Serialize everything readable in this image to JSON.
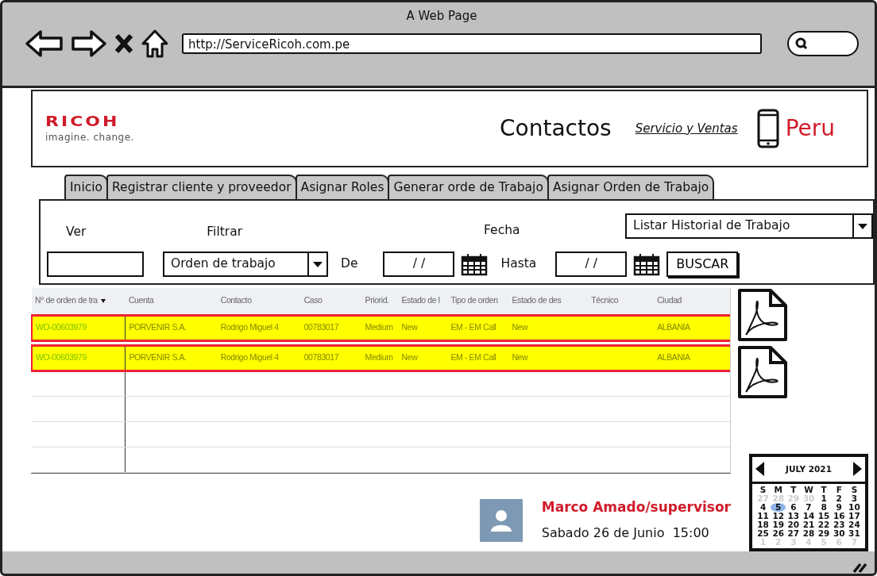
{
  "window": {
    "title": "A Web Page",
    "url": "http://ServiceRicoh.com.pe"
  },
  "header": {
    "logo": "RICOH",
    "tagline": "imagine. change.",
    "title": "Contactos",
    "link": "Servicio y Ventas",
    "country": "Peru"
  },
  "tabs": [
    {
      "label": "Inicio",
      "selected": false
    },
    {
      "label": "Registrar cliente y proveedor",
      "selected": false
    },
    {
      "label": "Asignar Roles",
      "selected": false
    },
    {
      "label": "Generar orde de Trabajo",
      "selected": false
    },
    {
      "label": "Asignar Orden de Trabajo",
      "selected": false
    }
  ],
  "filters": {
    "ver_label": "Ver",
    "filtrar_label": "Filtrar",
    "fecha_label": "Fecha",
    "list_select": "Listar Historial de Trabajo",
    "filtrar_select": "Orden de trabajo",
    "de_label": "De",
    "de_value": "/ /",
    "hasta_label": "Hasta",
    "hasta_value": "/ /",
    "search_button": "BUSCAR"
  },
  "table": {
    "columns": [
      "N° de orden de tra",
      "Cuenta",
      "Contacto",
      "Caso",
      "Priorid.",
      "Estado de l",
      "Tipo de orden",
      "Estado de des",
      "Técnico",
      "Ciudad"
    ],
    "rows": [
      {
        "highlighted": true,
        "cells": [
          "WO-00603979",
          "PORVENIR S.A.",
          "Rodrigo Miguel 4",
          "00783017",
          "Medium",
          "New",
          "EM - EM Call",
          "New",
          "",
          "ALBANIA"
        ]
      },
      {
        "highlighted": true,
        "cells": [
          "WO-00603979",
          "PORVENIR S.A.",
          "Rodrigo Miguel 4",
          "00783017",
          "Medium",
          "New",
          "EM - EM Call",
          "New",
          "",
          "ALBANIA"
        ]
      }
    ]
  },
  "user": {
    "name": "Marco Amado/supervisor",
    "date": "Sabado 26 de Junio  15:00"
  },
  "calendar": {
    "month": "JULY 2021",
    "weekdays": [
      "S",
      "M",
      "T",
      "W",
      "T",
      "F",
      "S"
    ],
    "days": [
      {
        "day": "27",
        "muted": true,
        "selected": false
      },
      {
        "day": "28",
        "muted": true,
        "selected": false
      },
      {
        "day": "29",
        "muted": true,
        "selected": false
      },
      {
        "day": "30",
        "muted": true,
        "selected": false
      },
      {
        "day": "1",
        "muted": false,
        "selected": false
      },
      {
        "day": "2",
        "muted": false,
        "selected": false
      },
      {
        "day": "3",
        "muted": false,
        "selected": false
      },
      {
        "day": "4",
        "muted": false,
        "selected": false
      },
      {
        "day": "5",
        "muted": false,
        "selected": true
      },
      {
        "day": "6",
        "muted": false,
        "selected": false
      },
      {
        "day": "7",
        "muted": false,
        "selected": false
      },
      {
        "day": "8",
        "muted": false,
        "selected": false
      },
      {
        "day": "9",
        "muted": false,
        "selected": false
      },
      {
        "day": "10",
        "muted": false,
        "selected": false
      },
      {
        "day": "11",
        "muted": false,
        "selected": false
      },
      {
        "day": "12",
        "muted": false,
        "selected": false
      },
      {
        "day": "13",
        "muted": false,
        "selected": false
      },
      {
        "day": "14",
        "muted": false,
        "selected": false
      },
      {
        "day": "15",
        "muted": false,
        "selected": false
      },
      {
        "day": "16",
        "muted": false,
        "selected": false
      },
      {
        "day": "17",
        "muted": false,
        "selected": false
      },
      {
        "day": "18",
        "muted": false,
        "selected": false
      },
      {
        "day": "19",
        "muted": false,
        "selected": false
      },
      {
        "day": "20",
        "muted": false,
        "selected": false
      },
      {
        "day": "21",
        "muted": false,
        "selected": false
      },
      {
        "day": "22",
        "muted": false,
        "selected": false
      },
      {
        "day": "23",
        "muted": false,
        "selected": false
      },
      {
        "day": "24",
        "muted": false,
        "selected": false
      },
      {
        "day": "25",
        "muted": false,
        "selected": false
      },
      {
        "day": "26",
        "muted": false,
        "selected": false
      },
      {
        "day": "27",
        "muted": false,
        "selected": false
      },
      {
        "day": "28",
        "muted": false,
        "selected": false
      },
      {
        "day": "29",
        "muted": false,
        "selected": false
      },
      {
        "day": "30",
        "muted": false,
        "selected": false
      },
      {
        "day": "31",
        "muted": false,
        "selected": false
      },
      {
        "day": "1",
        "muted": true,
        "selected": false
      },
      {
        "day": "2",
        "muted": true,
        "selected": false
      },
      {
        "day": "3",
        "muted": true,
        "selected": false
      },
      {
        "day": "4",
        "muted": true,
        "selected": false
      },
      {
        "day": "5",
        "muted": true,
        "selected": false
      },
      {
        "day": "6",
        "muted": true,
        "selected": false
      },
      {
        "day": "7",
        "muted": true,
        "selected": false
      }
    ]
  }
}
